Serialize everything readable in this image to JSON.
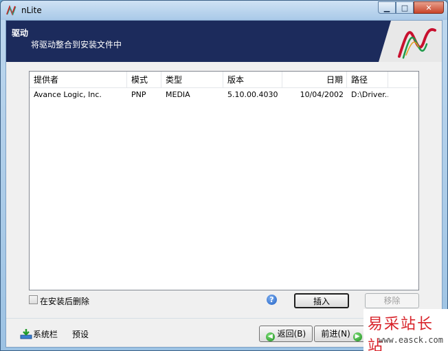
{
  "window": {
    "title": "nLite",
    "minimize": "▁",
    "maximize": "□",
    "close": "✕"
  },
  "banner": {
    "title": "驱动",
    "subtitle": "将驱动整合到安装文件中"
  },
  "list": {
    "columns": [
      "提供者",
      "模式",
      "类型",
      "版本",
      "日期",
      "路径"
    ],
    "rows": [
      [
        "Avance Logic, Inc.",
        "PNP",
        "MEDIA",
        "5.10.00.4030",
        "10/04/2002",
        "D:\\Driver..."
      ]
    ]
  },
  "options": {
    "delete_after_install": "在安装后删除",
    "help": "?",
    "insert": "插入",
    "remove": "移除"
  },
  "footer": {
    "taskbar": "系统栏",
    "preset": "预设",
    "back": "返回(B)",
    "next": "前进(N)"
  },
  "watermark": {
    "name": "易采站长站",
    "url": "www.easck.com"
  },
  "colors": {
    "banner": "#1c2b5c",
    "accent_green": "#198b1a",
    "help_blue": "#1f5fc4"
  }
}
